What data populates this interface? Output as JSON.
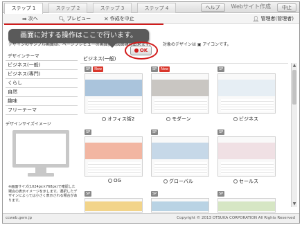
{
  "tabs": [
    {
      "label": "ステップ 1",
      "active": true
    },
    {
      "label": "ステップ 2",
      "active": false
    },
    {
      "label": "ステップ 3",
      "active": false
    },
    {
      "label": "ステップ 4",
      "active": false
    }
  ],
  "top_right": {
    "help": "ヘルプ",
    "title": "Webサイト作成",
    "stop": "中止"
  },
  "toolbar": {
    "next": "次へ",
    "preview": "プレビュー",
    "cancel": "作成を中止",
    "admin": "管理者(管理者)"
  },
  "callout": {
    "text": "画面に対する操作はここで行います。",
    "ok": "OK"
  },
  "description": {
    "left": "デザインのサンプル画面は、ページプレビューの画面拡大図面確認出来ます。",
    "right": "対象のデザインは ▣ アイコンです。"
  },
  "sidebar": {
    "heading": "デザインテーマ",
    "items": [
      "ビジネス(一般)",
      "ビジネス(専門)",
      "くらし",
      "自然",
      "趣味",
      "フリーテーマ"
    ],
    "size_heading": "デザインサイズイメージ",
    "note": "※画面サイズ(1024px×768px)で確認した場合の表示イメージを示します。選択したデザインによっては小さく表示される場合があります。"
  },
  "content": {
    "category_title": "ビジネス(一般)",
    "designs": [
      {
        "name": "オフィス街2",
        "new": true,
        "hero_color": "#aac4dc"
      },
      {
        "name": "モダーン",
        "new": true,
        "hero_color": "#c9c6c2"
      },
      {
        "name": "ビジネス",
        "new": false,
        "hero_color": "#e6eef4"
      },
      {
        "name": "OG",
        "new": false,
        "hero_color": "#f2b6a2"
      },
      {
        "name": "グローバル",
        "new": false,
        "hero_color": "#c6d8e8"
      },
      {
        "name": "セールス",
        "new": false,
        "hero_color": "#f0e0e4"
      }
    ],
    "badges": {
      "sp": "SP",
      "new": "New"
    }
  },
  "footer": {
    "left": "ccweb.gem.jp",
    "right": "Copyright © 2013 OTSUKA CORPORATION All Rights Reserved"
  },
  "colors": {
    "accent_red": "#d21c1c",
    "callout_bg": "#5a5a5a"
  }
}
